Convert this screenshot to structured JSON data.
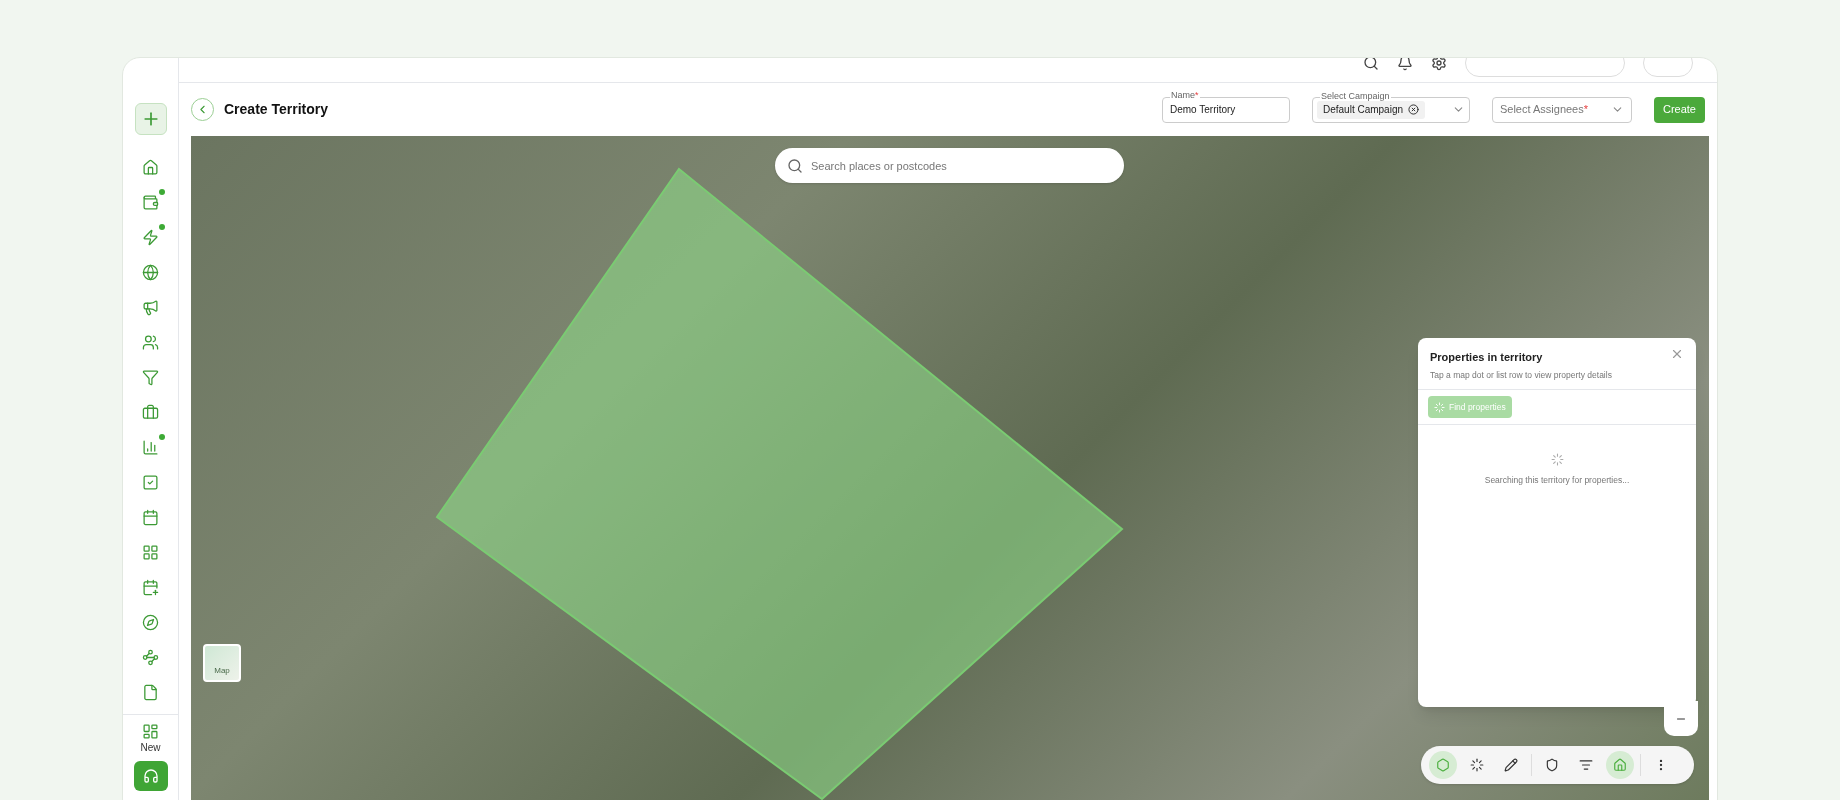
{
  "sidebar": {
    "items": [
      {
        "dot": false
      },
      {
        "dot": true
      },
      {
        "dot": true
      },
      {
        "dot": false
      },
      {
        "dot": false
      },
      {
        "dot": false
      },
      {
        "dot": false
      },
      {
        "dot": false
      },
      {
        "dot": true
      },
      {
        "dot": false
      },
      {
        "dot": false
      },
      {
        "dot": false
      },
      {
        "dot": false
      },
      {
        "dot": false
      },
      {
        "dot": false
      },
      {
        "dot": false
      }
    ],
    "new_label": "New"
  },
  "header": {
    "title": "Create Territory",
    "name_field": {
      "label": "Name",
      "required_mark": "*",
      "value": "Demo Territory"
    },
    "campaign_field": {
      "label": "Select Campaign",
      "chip": "Default Campaign"
    },
    "assignees_field": {
      "placeholder": "Select Assignees",
      "required_mark": "*"
    },
    "create_button": "Create"
  },
  "map": {
    "search": {
      "placeholder": "Search places or postcodes"
    },
    "layer_toggle": "Map",
    "tools": [
      {
        "selected": true
      },
      {
        "selected": false
      },
      {
        "selected": false
      },
      {
        "selected": false
      },
      {
        "selected": false
      },
      {
        "selected": true
      },
      {
        "selected": false
      }
    ]
  },
  "panel": {
    "title": "Properties in territory",
    "subtitle": "Tap a map dot or list row to view property details",
    "find_button": "Find properties",
    "status": "Searching this territory for properties..."
  }
}
